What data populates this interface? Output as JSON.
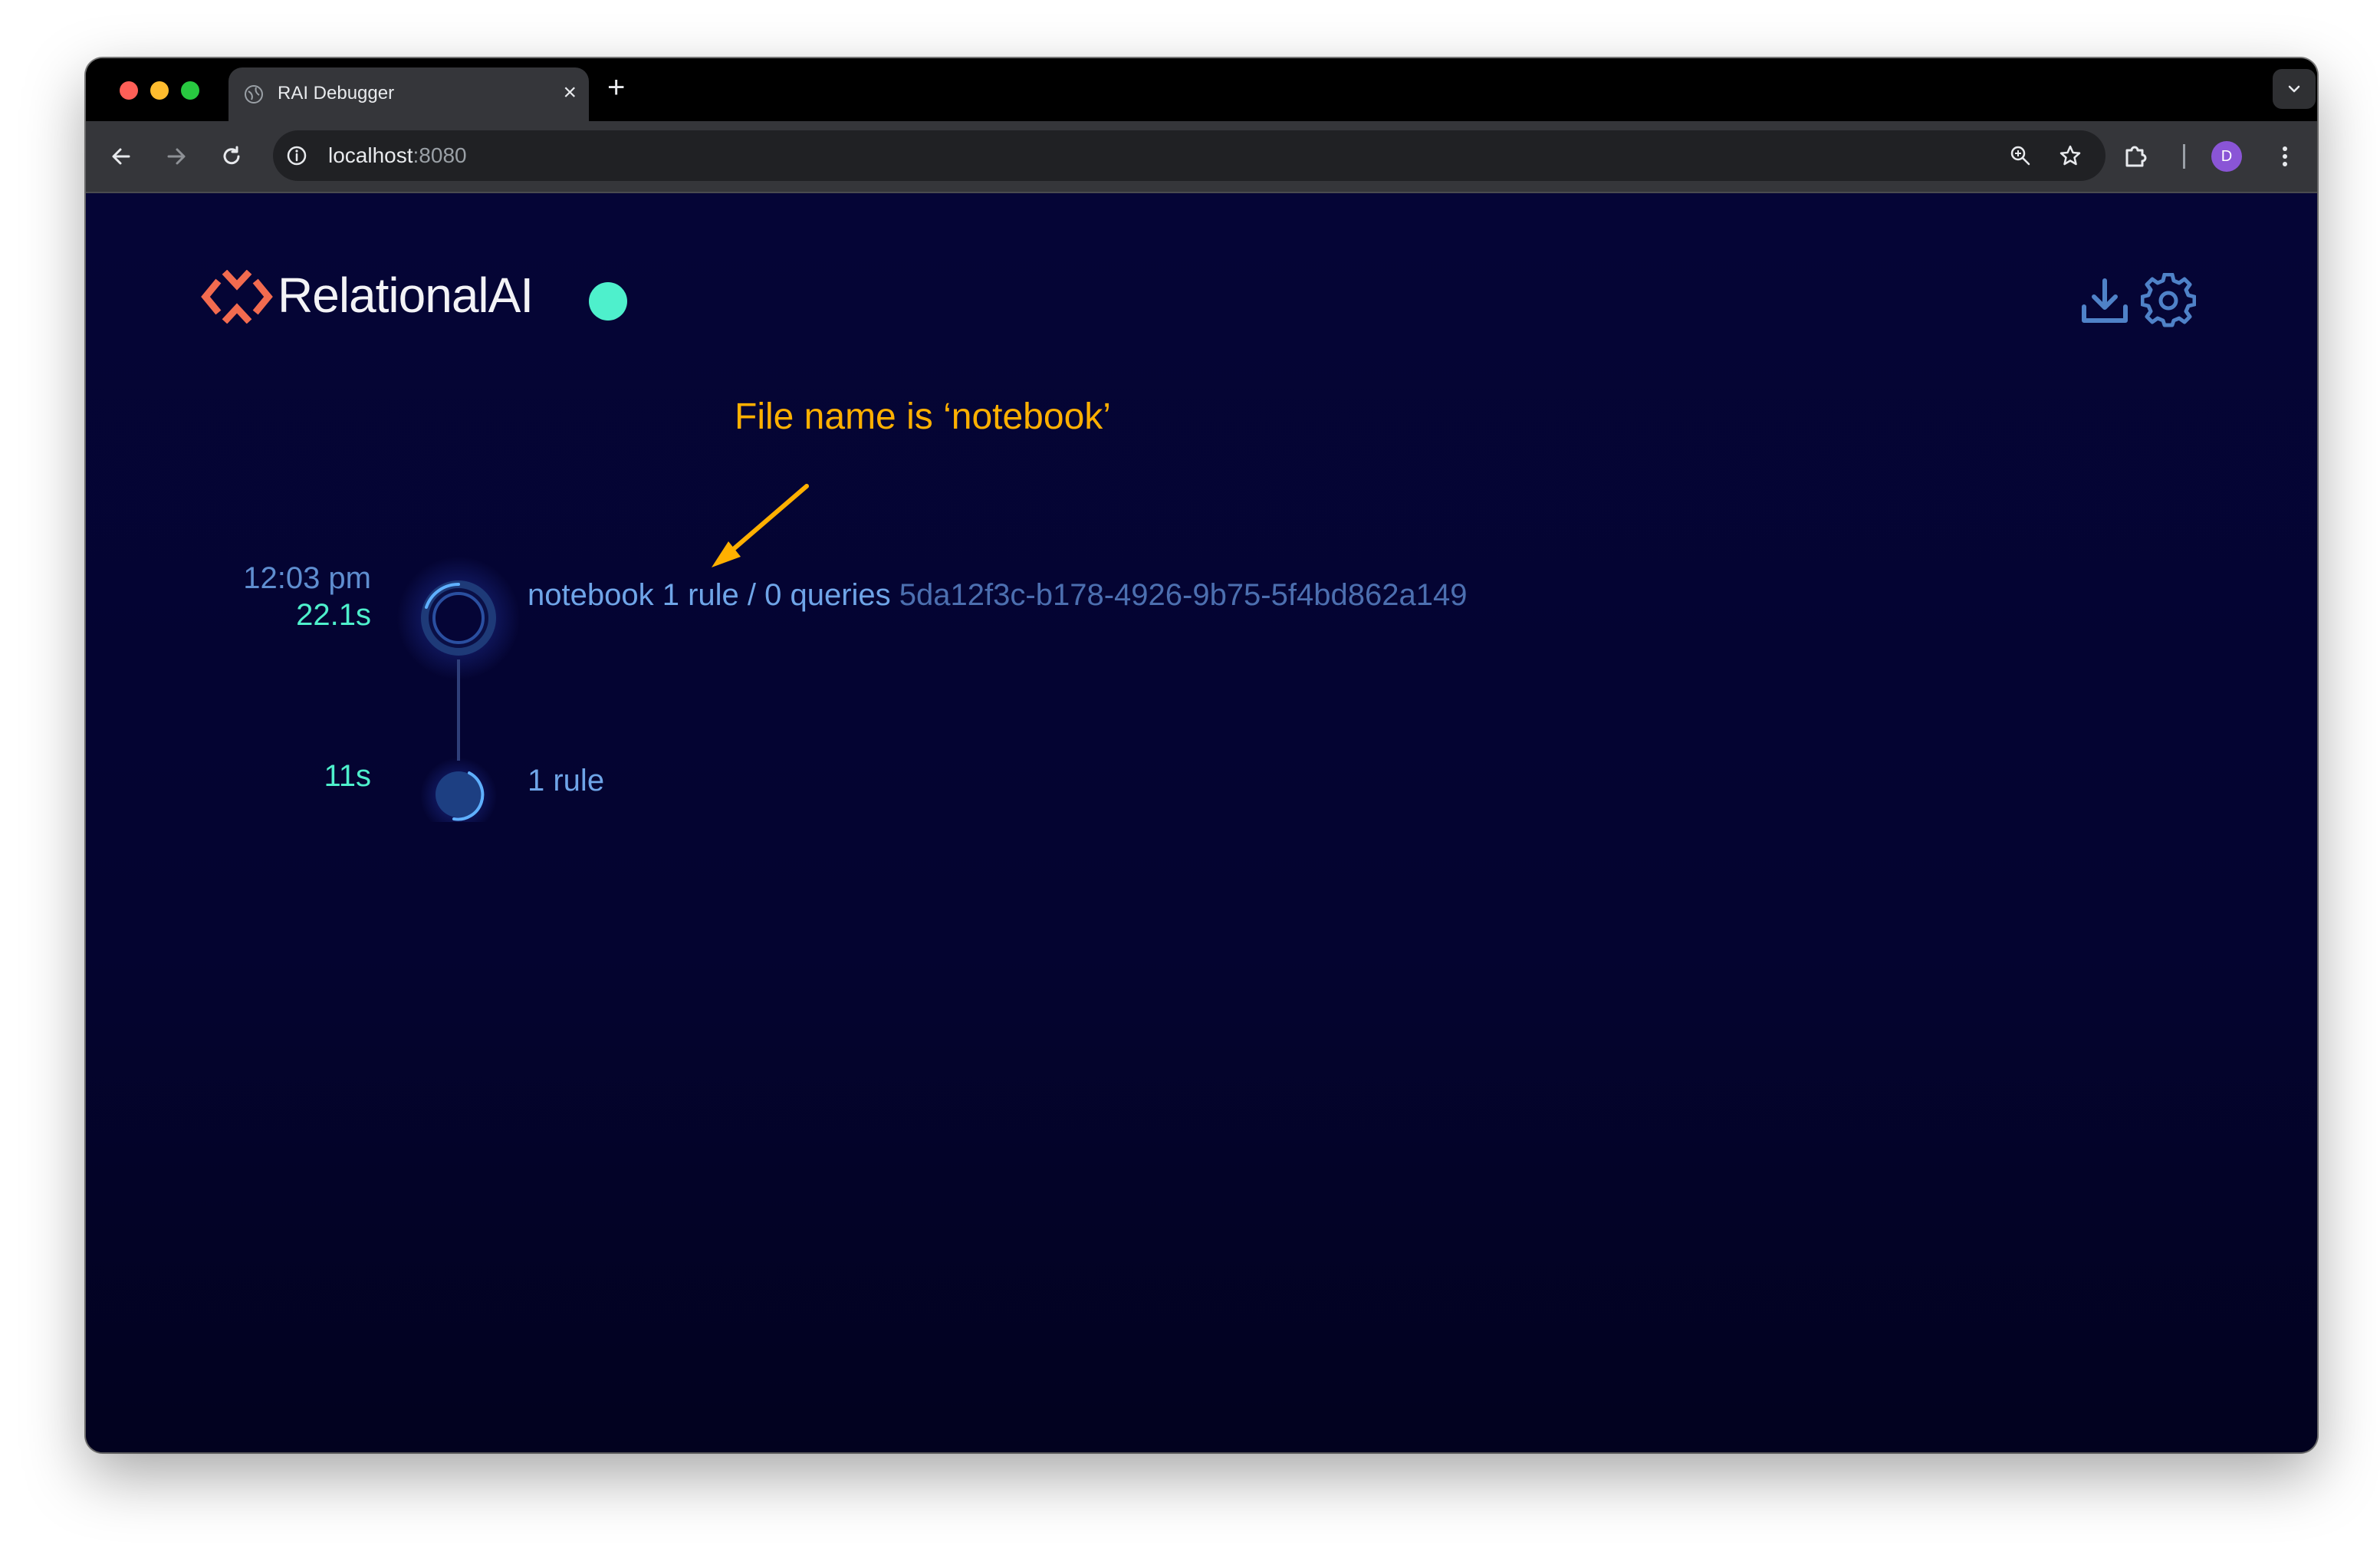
{
  "browser": {
    "tab_title": "RAI Debugger",
    "tab_close": "×",
    "new_tab": "+",
    "url_host": "localhost",
    "url_port": ":8080",
    "avatar_initial": "D"
  },
  "app": {
    "brand": "RelationalAI",
    "status": "connected",
    "accent_color": "#4ef0cc",
    "brand_color": "#f26b4f"
  },
  "annotation": {
    "text": "File name is ‘notebook’",
    "color": "#ffb000"
  },
  "timeline": {
    "transactions": [
      {
        "time": "12:03 pm",
        "duration": "22.1s",
        "name": "notebook",
        "summary": "1 rule / 0 queries",
        "id": "5da12f3c-b178-4926-9b75-5f4bd862a149"
      }
    ],
    "steps": [
      {
        "duration": "11s",
        "label": "1 rule"
      }
    ]
  }
}
